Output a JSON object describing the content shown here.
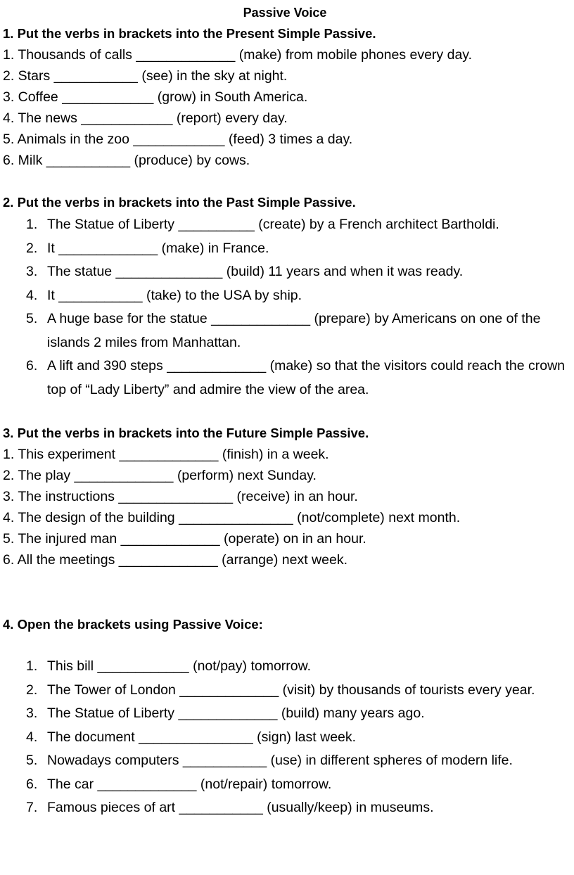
{
  "document": {
    "title": "Passive Voice"
  },
  "sections": [
    {
      "heading": "1. Put the verbs in brackets into the Present Simple Passive.",
      "list_style": "flat",
      "items": [
        "1. Thousands of calls _____________ (make) from mobile phones every day.",
        "2. Stars ___________ (see) in the sky at night.",
        "3. Coffee ____________ (grow) in South America.",
        "4. The news ____________ (report) every day.",
        "5. Animals in the zoo ____________ (feed) 3 times a day.",
        "6. Milk ___________ (produce) by cows."
      ]
    },
    {
      "heading": "2. Put the verbs in brackets into the Past Simple Passive.",
      "list_style": "indent",
      "items": [
        {
          "num": "1.",
          "text": "The Statue of Liberty __________ (create) by a French architect Bartholdi."
        },
        {
          "num": "2.",
          "text": "It _____________ (make) in France."
        },
        {
          "num": "3.",
          "text": "The statue ______________ (build) 11 years and when it was ready."
        },
        {
          "num": "4.",
          "text": "It ___________ (take) to the USA by ship."
        },
        {
          "num": "5.",
          "text": "A huge base for the statue _____________ (prepare) by Americans on one of the islands 2 miles from Manhattan."
        },
        {
          "num": "6.",
          "text": " A lift and 390 steps _____________ (make) so that the visitors could reach the crown top of “Lady Liberty” and admire the view of the area."
        }
      ]
    },
    {
      "heading": "3. Put the verbs in brackets into the Future Simple Passive.",
      "list_style": "flat",
      "items": [
        "1. This experiment _____________ (finish) in a week.",
        "2. The play _____________ (perform) next Sunday.",
        "3. The instructions _______________ (receive) in an hour.",
        "4. The design of the building _______________ (not/complete) next month.",
        "5. The injured man _____________ (operate) on in an hour.",
        "6. All the meetings _____________ (arrange) next week."
      ]
    },
    {
      "heading": "4. Open the brackets using Passive Voice:",
      "list_style": "indent",
      "items": [
        {
          "num": "1.",
          "text": "This bill ____________ (not/pay) tomorrow."
        },
        {
          "num": "2.",
          "text": "The Tower of London _____________ (visit) by thousands of tourists every year."
        },
        {
          "num": "3.",
          "text": "The Statue of Liberty _____________ (build) many years ago."
        },
        {
          "num": "4.",
          "text": "The document _______________ (sign) last week."
        },
        {
          "num": "5.",
          "text": "Nowadays computers ___________ (use) in different spheres of modern life."
        },
        {
          "num": "6.",
          "text": "The car _____________ (not/repair) tomorrow."
        },
        {
          "num": "7.",
          "text": "Famous pieces of art ___________ (usually/keep) in museums."
        }
      ]
    }
  ]
}
